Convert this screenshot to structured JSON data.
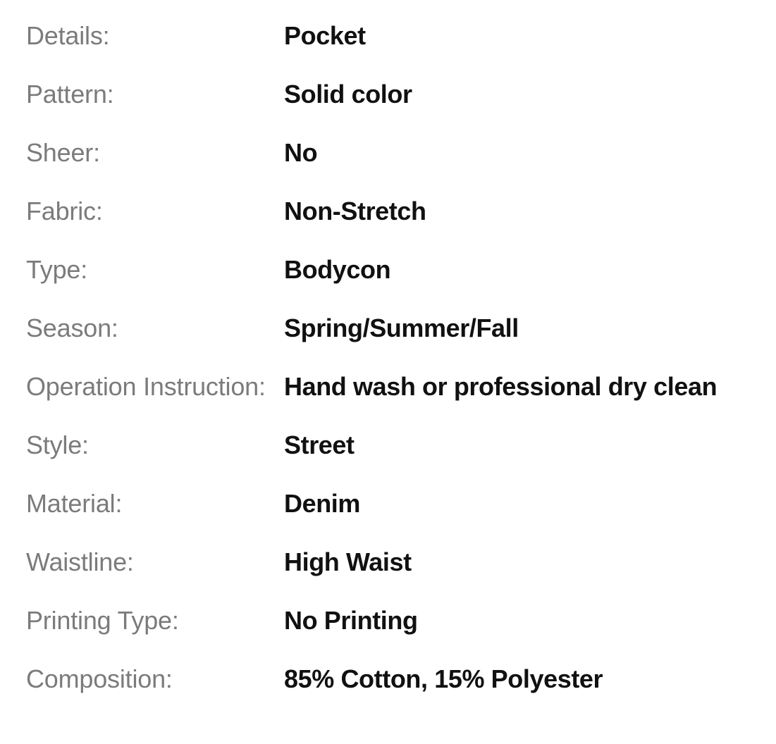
{
  "page": {
    "name": "product-attribute-list",
    "background_color": "#ffffff",
    "label_color": "#7b7b7b",
    "value_color": "#111111"
  },
  "specs": {
    "rows": [
      {
        "label": "Details:",
        "value": "Pocket"
      },
      {
        "label": "Pattern:",
        "value": "Solid color"
      },
      {
        "label": "Sheer:",
        "value": "No"
      },
      {
        "label": "Fabric:",
        "value": "Non-Stretch"
      },
      {
        "label": "Type:",
        "value": "Bodycon"
      },
      {
        "label": "Season:",
        "value": "Spring/Summer/Fall"
      },
      {
        "label": "Operation Instruction:",
        "value": "Hand wash or professional dry clean"
      },
      {
        "label": "Style:",
        "value": "Street"
      },
      {
        "label": "Material:",
        "value": "Denim"
      },
      {
        "label": "Waistline:",
        "value": "High Waist"
      },
      {
        "label": "Printing Type:",
        "value": "No Printing"
      },
      {
        "label": "Composition:",
        "value": "85% Cotton, 15% Polyester"
      }
    ]
  }
}
